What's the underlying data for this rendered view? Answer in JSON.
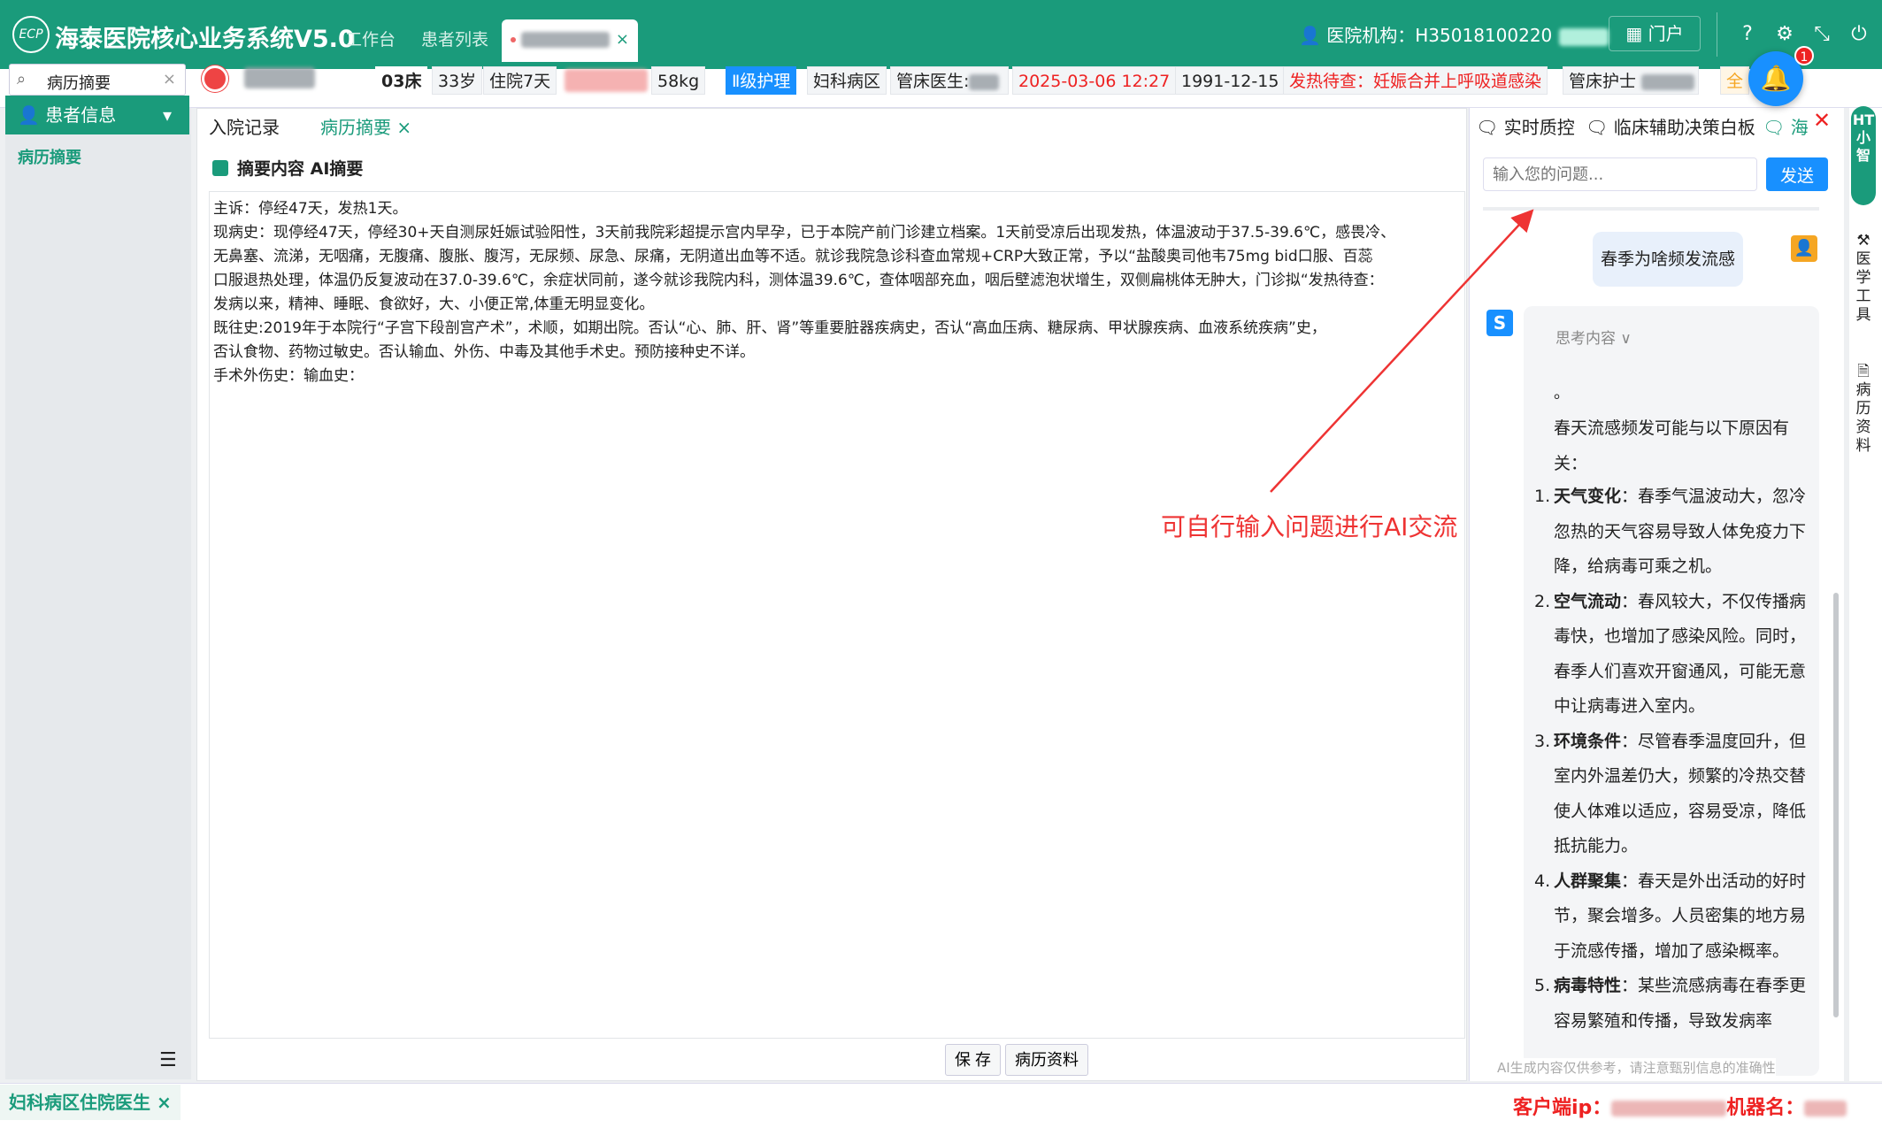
{
  "app": {
    "logo_text": "ECP",
    "title": "海泰医院核心业务系统V5.0"
  },
  "top_tabs": [
    "工作台",
    "患者列表"
  ],
  "header": {
    "org_label": "医院机构：H35018100220",
    "portal_label": "门户"
  },
  "search": {
    "value": "病历摘要"
  },
  "patient": {
    "bed": "03床",
    "age": "33岁",
    "stay": "住院7天",
    "weight": "58kg",
    "care_level": "Ⅱ级护理",
    "ward": "妇科病区",
    "doctor_label": "管床医生:",
    "admit_time": "2025-03-06 12:27",
    "dob": "1991-12-15",
    "pending_dx": "发热待查：妊娠合并上呼吸道感染",
    "nurse_label": "管床护士",
    "more_label": "全"
  },
  "sidebar": {
    "menu_title": "患者信息",
    "items": [
      "病历摘要"
    ]
  },
  "subtabs": [
    "入院记录",
    "病历摘要"
  ],
  "summary": {
    "header": "摘要内容  AI摘要",
    "lines": [
      "主诉：停经47天，发热1天。",
      "现病史：现停经47天，停经30+天自测尿妊娠试验阳性，3天前我院彩超提示宫内早孕，已于本院产前门诊建立档案。1天前受凉后出现发热，体温波动于37.5-39.6℃，感畏冷、",
      "无鼻塞、流涕，无咽痛，无腹痛、腹胀、腹泻，无尿频、尿急、尿痛，无阴道出血等不适。就诊我院急诊科查血常规+CRP大致正常，予以“盐酸奥司他韦75mg bid口服、百蕊",
      "口服退热处理，体温仍反复波动在37.0-39.6℃，余症状同前，遂今就诊我院内科，测体温39.6℃，查体咽部充血，咽后壁滤泡状增生，双侧扁桃体无肿大，门诊拟“发热待查：",
      "发病以来，精神、睡眠、食欲好，大、小便正常,体重无明显变化。",
      "既往史:2019年于本院行“子宫下段剖宫产术”，术顺，如期出院。否认“心、肺、肝、肾”等重要脏器疾病史，否认“高血压病、糖尿病、甲状腺疾病、血液系统疾病”史，",
      "否认食物、药物过敏史。否认输血、外伤、中毒及其他手术史。预防接种史不详。",
      "手术外伤史：输血史："
    ]
  },
  "footer_buttons": {
    "save": "保 存",
    "records": "病历资料"
  },
  "ai_panel": {
    "tabs": [
      "实时质控",
      "临床辅助决策白板",
      "海"
    ],
    "input_placeholder": "输入您的问题...",
    "send_label": "发送",
    "user_message": "春季为啥频发流感",
    "thinking_label": "思考内容 ∨",
    "bot_dot": "。",
    "bot_intro": "春天流感频发可能与以下原因有关：",
    "bot_points": [
      {
        "num": "1.",
        "title": "天气变化",
        "text": "：春季气温波动大，忽冷忽热的天气容易导致人体免疫力下降，给病毒可乘之机。"
      },
      {
        "num": "2.",
        "title": "空气流动",
        "text": "：春风较大，不仅传播病毒快，也增加了感染风险。同时，春季人们喜欢开窗通风，可能无意中让病毒进入室内。"
      },
      {
        "num": "3.",
        "title": "环境条件",
        "text": "：尽管春季温度回升，但室内外温差仍大，频繁的冷热交替使人体难以适应，容易受凉，降低抵抗能力。"
      },
      {
        "num": "4.",
        "title": "人群聚集",
        "text": "：春天是外出活动的好时节，聚会增多。人员密集的地方易于流感传播，增加了感染概率。"
      },
      {
        "num": "5.",
        "title": "病毒特性",
        "text": "：某些流感病毒在春季更容易繁殖和传播，导致发病率"
      }
    ],
    "disclaimer": "AI生成内容仅供参考，请注意甄别信息的准确性"
  },
  "right_rail": {
    "ht_label": "HT小智",
    "tool_label": "医学工具",
    "records_label": "病历资料"
  },
  "notification": {
    "count": "1"
  },
  "annotation": "可自行输入问题进行AI交流",
  "bottom": {
    "tab_label": "妇科病区住院医生",
    "client_ip_label": "客户端ip：",
    "machine_label": "机器名："
  },
  "colors": {
    "primary": "#1a9b7b",
    "accent_blue": "#1890ff",
    "alert_red": "#e22222"
  }
}
